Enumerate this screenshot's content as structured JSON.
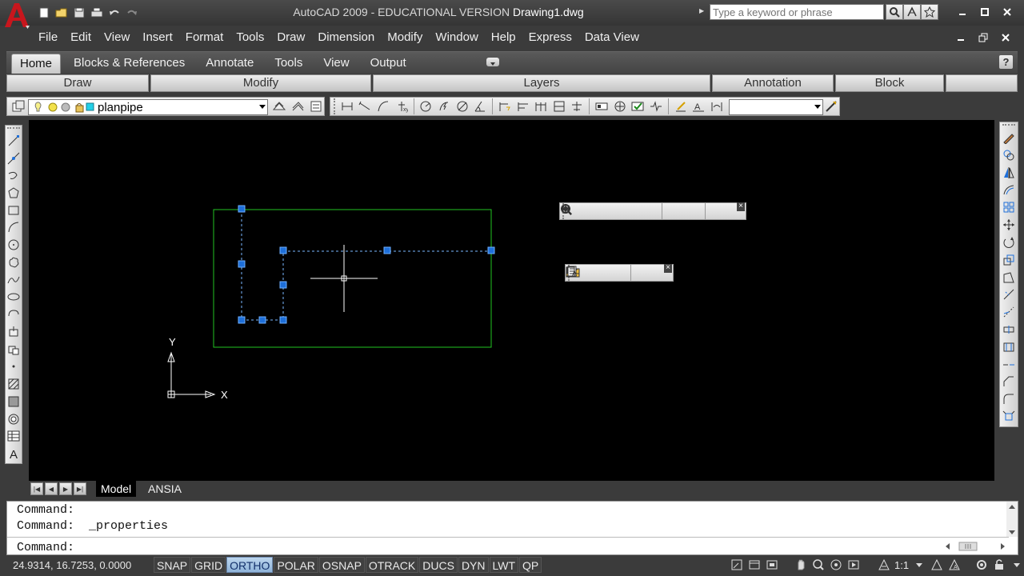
{
  "window": {
    "title_app": "AutoCAD 2009 - EDUCATIONAL VERSION",
    "title_doc": "Drawing1.dwg",
    "search_placeholder": "Type a keyword or phrase"
  },
  "menu": [
    "File",
    "Edit",
    "View",
    "Insert",
    "Format",
    "Tools",
    "Draw",
    "Dimension",
    "Modify",
    "Window",
    "Help",
    "Express",
    "Data View"
  ],
  "ribbon": {
    "tabs": [
      "Home",
      "Blocks & References",
      "Annotate",
      "Tools",
      "View",
      "Output"
    ],
    "active_tab": "Home",
    "panels": [
      "Draw",
      "Modify",
      "Layers",
      "Annotation",
      "Block"
    ]
  },
  "layer": {
    "current": "planpipe"
  },
  "canvas": {
    "ucs_y": "Y",
    "ucs_x": "X",
    "grip_color": "#1e6fd9",
    "rectangle_color": "#22c422"
  },
  "layout_tabs": [
    "Model",
    "ANSIA"
  ],
  "command_lines": [
    "Command:",
    "Command:  _properties",
    "Command:"
  ],
  "status": {
    "coords": "24.9314, 16.7253, 0.0000",
    "toggles": [
      {
        "label": "SNAP",
        "on": false
      },
      {
        "label": "GRID",
        "on": false
      },
      {
        "label": "ORTHO",
        "on": true
      },
      {
        "label": "POLAR",
        "on": false
      },
      {
        "label": "OSNAP",
        "on": false
      },
      {
        "label": "OTRACK",
        "on": false
      },
      {
        "label": "DUCS",
        "on": false
      },
      {
        "label": "DYN",
        "on": false
      },
      {
        "label": "LWT",
        "on": false
      },
      {
        "label": "QP",
        "on": false
      }
    ],
    "annotation_scale": "1:1"
  },
  "colors": {
    "accent_blue": "#1e6fd9",
    "ortho_on": "#a7c6e6",
    "logo_red": "#c8161d"
  }
}
